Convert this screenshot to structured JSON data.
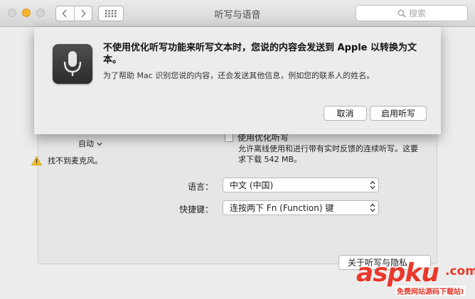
{
  "window": {
    "title": "听写与语音",
    "search_placeholder": "搜索"
  },
  "sheet": {
    "title": "不使用优化听写功能来听写文本时，您说的内容会发送到 Apple 以转换为文本。",
    "body": "为了帮助 Mac 识别您说的内容，还会发送其他信息，例如您的联系人的姓名。",
    "cancel_label": "取消",
    "enable_label": "启用听写"
  },
  "pane": {
    "input_value": "自动",
    "warning_text": "找不到麦克风。",
    "enhanced_label": "使用优化听写",
    "enhanced_checked": false,
    "enhanced_desc": "允许离线使用和进行带有实时反馈的连续听写。这要求下载 542 MB。",
    "language_label": "语言：",
    "language_value": "中文 (中国)",
    "shortcut_label": "快捷键：",
    "shortcut_value": "连按两下 Fn (Function) 键",
    "about_button": "关于听写与隐私"
  },
  "watermark": {
    "text": "aspku",
    "dot": ".com",
    "subtext": "免费网站源码下载站!"
  },
  "colors": {
    "accent_yellow": "#f5b22c",
    "watermark_red": "#e8392a"
  },
  "icons": {
    "back": "chevron-left-icon",
    "forward": "chevron-right-icon",
    "grid": "grid-icon",
    "search": "search-icon",
    "mic": "microphone-icon",
    "warning": "warning-icon",
    "popup": "updown-arrows-icon"
  }
}
